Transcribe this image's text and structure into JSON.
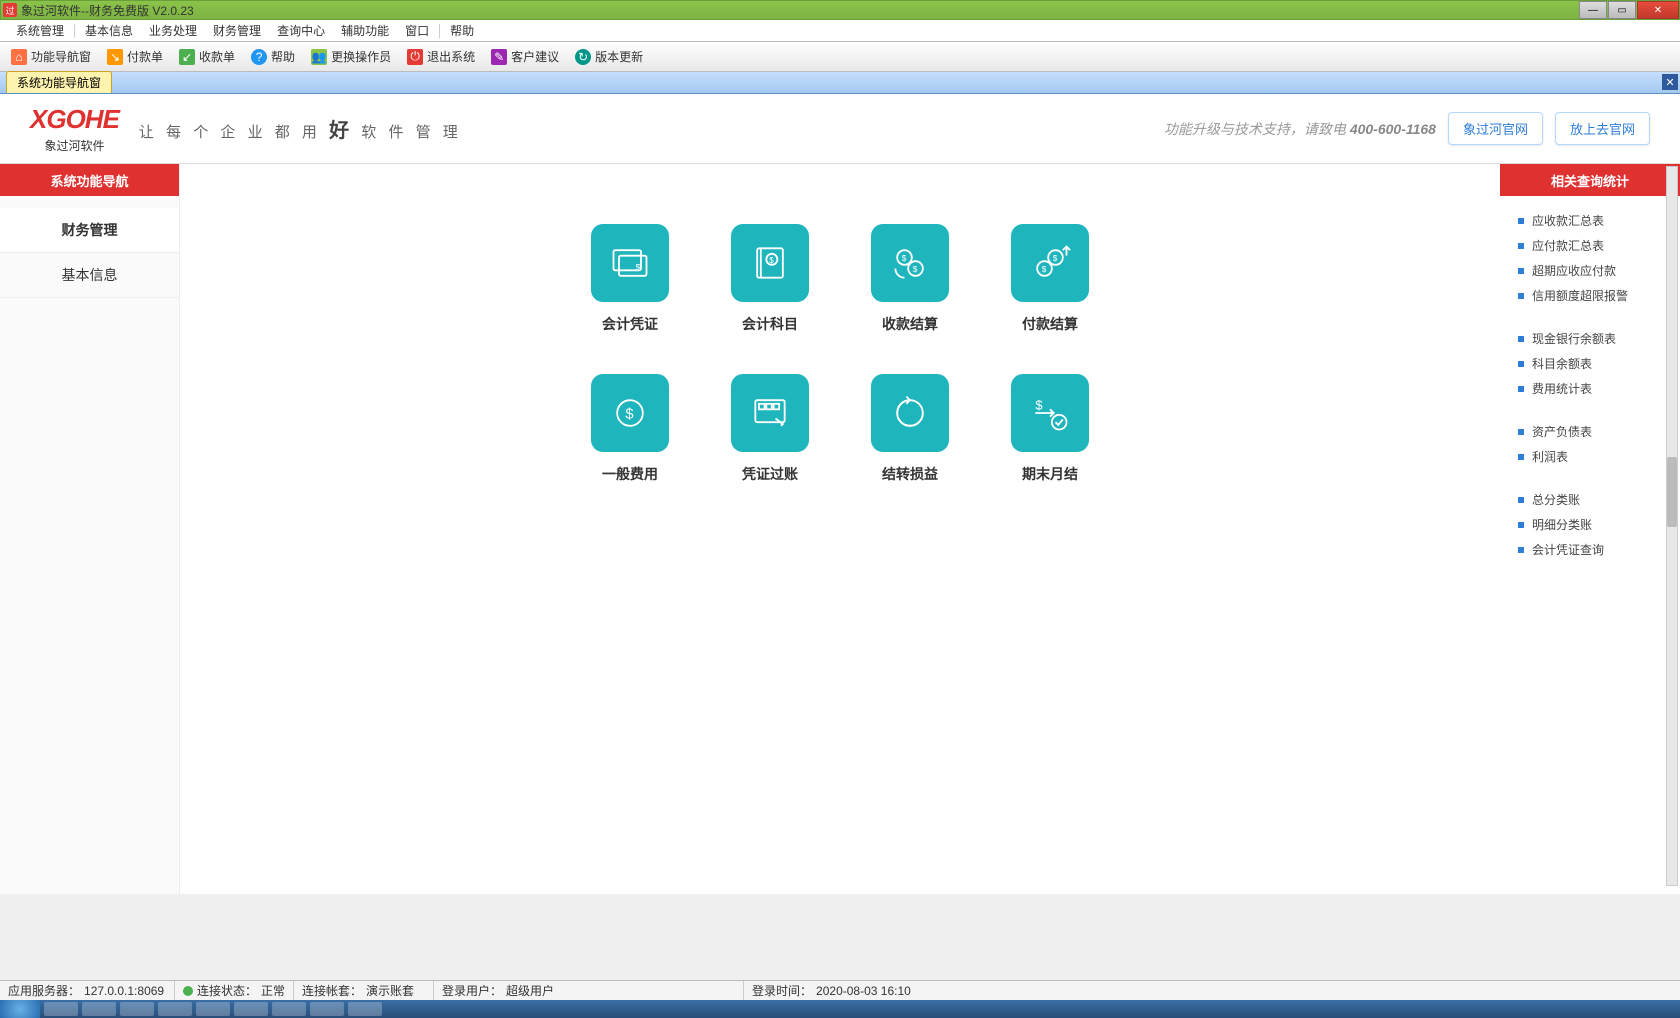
{
  "window": {
    "title": "象过河软件--财务免费版 V2.0.23"
  },
  "menus": [
    "系统管理",
    "基本信息",
    "业务处理",
    "财务管理",
    "查询中心",
    "辅助功能",
    "窗口",
    "帮助"
  ],
  "toolbar": [
    {
      "id": "nav",
      "label": "功能导航窗"
    },
    {
      "id": "pay",
      "label": "付款单"
    },
    {
      "id": "recv",
      "label": "收款单"
    },
    {
      "id": "help",
      "label": "帮助"
    },
    {
      "id": "switch",
      "label": "更换操作员"
    },
    {
      "id": "exit",
      "label": "退出系统"
    },
    {
      "id": "suggest",
      "label": "客户建议"
    },
    {
      "id": "update",
      "label": "版本更新"
    }
  ],
  "tab": {
    "active": "系统功能导航窗"
  },
  "logo": {
    "main": "XGOHE",
    "sub": "象过河软件"
  },
  "slogan": {
    "pre": "让 每 个 企 业 都 用 ",
    "big": "好",
    "post": " 软 件 管 理"
  },
  "support": {
    "text": "功能升级与技术支持，请致电 ",
    "phone": "400-600-1168"
  },
  "links": {
    "official": "象过河官网",
    "deploy": "放上去官网"
  },
  "left": {
    "header": "系统功能导航",
    "items": [
      "财务管理",
      "基本信息"
    ]
  },
  "tiles": [
    {
      "id": "voucher",
      "label": "会计凭证"
    },
    {
      "id": "subject",
      "label": "会计科目"
    },
    {
      "id": "recv-settle",
      "label": "收款结算"
    },
    {
      "id": "pay-settle",
      "label": "付款结算"
    },
    {
      "id": "expense",
      "label": "一般费用"
    },
    {
      "id": "post",
      "label": "凭证过账"
    },
    {
      "id": "carry",
      "label": "结转损益"
    },
    {
      "id": "monthend",
      "label": "期末月结"
    }
  ],
  "right": {
    "header": "相关查询统计",
    "groups": [
      [
        "应收款汇总表",
        "应付款汇总表",
        "超期应收应付款",
        "信用额度超限报警"
      ],
      [
        "现金银行余额表",
        "科目余额表",
        "费用统计表"
      ],
      [
        "资产负债表",
        "利润表"
      ],
      [
        "总分类账",
        "明细分类账",
        "会计凭证查询"
      ]
    ]
  },
  "status": {
    "server_label": "应用服务器：",
    "server_val": "127.0.0.1:8069",
    "conn_label": "连接状态：",
    "conn_val": "正常",
    "acct_label": "连接帐套：",
    "acct_val": "演示账套",
    "user_label": "登录用户：",
    "user_val": "超级用户",
    "time_label": "登录时间：",
    "time_val": "2020-08-03 16:10"
  }
}
